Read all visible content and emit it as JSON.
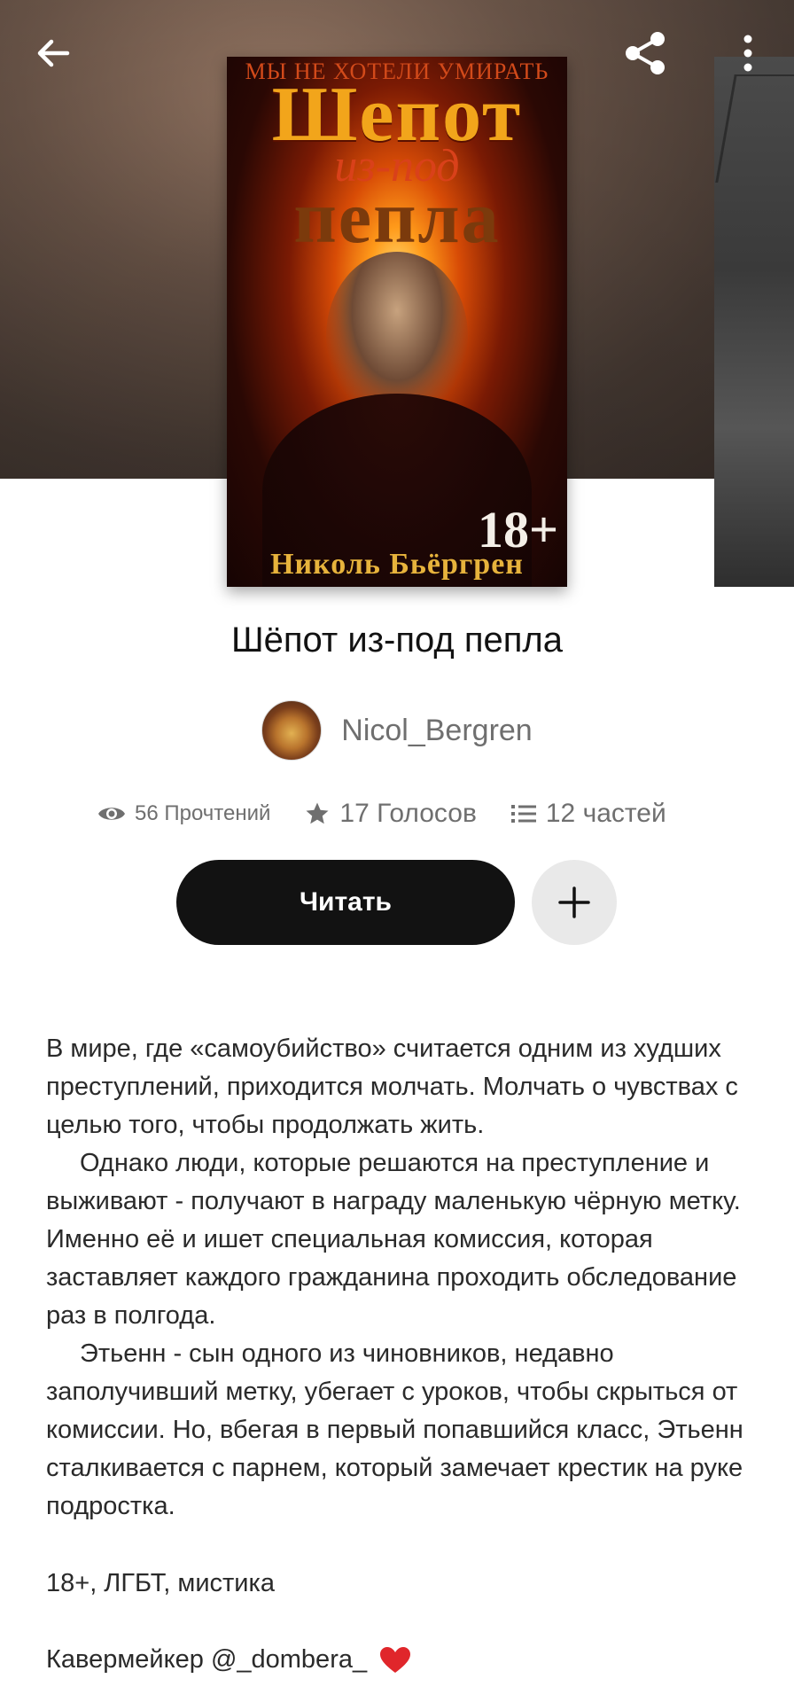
{
  "header": {
    "back_icon": "arrow-left-icon",
    "share_icon": "share-icon",
    "more_icon": "more-vertical-icon"
  },
  "cover": {
    "tagline": "Мы не хотели умирать",
    "title_line1": "Шепот",
    "title_middle": "из-под",
    "title_line2": "пепла",
    "age": "18+",
    "author": "Николь Бьёргрен"
  },
  "book": {
    "title": "Шёпот из-под пепла",
    "author": "Nicol_Bergren"
  },
  "stats": {
    "reads": "56 Прочтений",
    "votes": "17 Голосов",
    "parts": "12 частей"
  },
  "actions": {
    "read_label": "Читать",
    "add_icon": "plus-icon"
  },
  "description": {
    "p1": "В мире, где «самоубийство» считается одним из худших преступлений, приходится молчать. Молчать о чувствах с целью того, чтобы продолжать жить.",
    "p2": "Однако люди, которые решаются на преступление и выживают - получают в награду маленькую чёрную метку. Именно её и ишет специальная комиссия, которая заставляет каждого гражданина проходить обследование раз в полгода.",
    "p3": "Этьенн - сын одного из чиновников, недавно заполучивший метку, убегает с уроков, чтобы скрыться от комиссии. Но, вбегая в первый попавшийся класс, Этьенн сталкивается с парнем, который замечает крестик на руке подростка.",
    "tags": "18+, ЛГБТ, мистика",
    "credit": "Кавермейкер @_dombera_"
  },
  "colors": {
    "button_dark": "#121212",
    "button_light": "#e9e9e9",
    "muted_text": "#6f6f6f",
    "heart": "#e0262b"
  }
}
